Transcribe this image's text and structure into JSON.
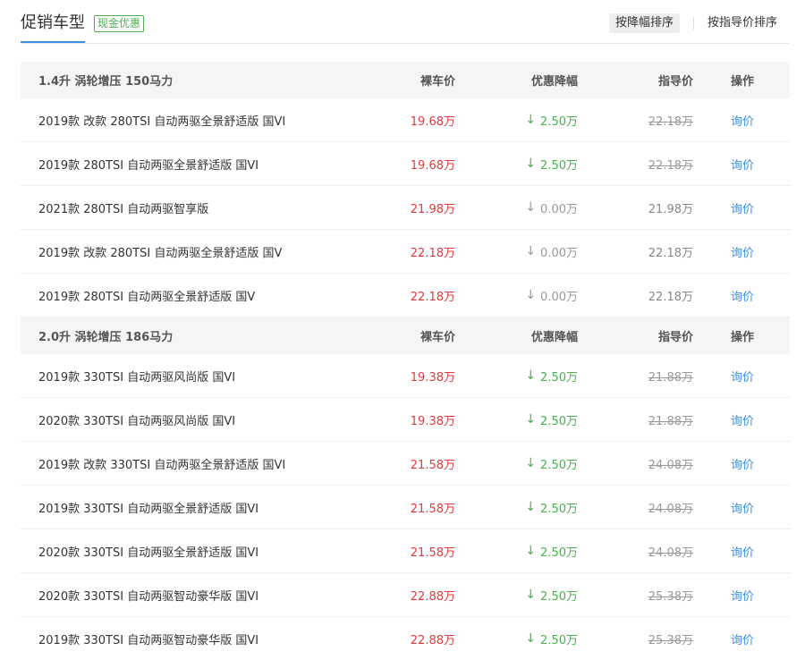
{
  "header": {
    "title": "促销车型",
    "badge": "现金优惠",
    "sort_by_discount": "按降幅排序",
    "sort_by_guide": "按指导价排序"
  },
  "groups": [
    {
      "name": "1.4升 涡轮增压 150马力",
      "col_price": "裸车价",
      "col_discount": "优惠降幅",
      "col_guide": "指导价",
      "col_op": "操作",
      "rows": [
        {
          "name": "2019款 改款 280TSI 自动两驱全景舒适版 国VI",
          "price": "19.68万",
          "discount": "2.50万",
          "guide": "22.18万",
          "op": "询价"
        },
        {
          "name": "2019款 280TSI 自动两驱全景舒适版 国VI",
          "price": "19.68万",
          "discount": "2.50万",
          "guide": "22.18万",
          "op": "询价"
        },
        {
          "name": "2021款 280TSI 自动两驱智享版",
          "price": "21.98万",
          "discount": "0.00万",
          "guide": "21.98万",
          "op": "询价"
        },
        {
          "name": "2019款 改款 280TSI 自动两驱全景舒适版 国V",
          "price": "22.18万",
          "discount": "0.00万",
          "guide": "22.18万",
          "op": "询价"
        },
        {
          "name": "2019款 280TSI 自动两驱全景舒适版 国V",
          "price": "22.18万",
          "discount": "0.00万",
          "guide": "22.18万",
          "op": "询价"
        }
      ]
    },
    {
      "name": "2.0升 涡轮增压 186马力",
      "col_price": "裸车价",
      "col_discount": "优惠降幅",
      "col_guide": "指导价",
      "col_op": "操作",
      "rows": [
        {
          "name": "2019款 330TSI 自动两驱风尚版 国VI",
          "price": "19.38万",
          "discount": "2.50万",
          "guide": "21.88万",
          "op": "询价"
        },
        {
          "name": "2020款 330TSI 自动两驱风尚版 国VI",
          "price": "19.38万",
          "discount": "2.50万",
          "guide": "21.88万",
          "op": "询价"
        },
        {
          "name": "2019款 改款 330TSI 自动两驱全景舒适版 国VI",
          "price": "21.58万",
          "discount": "2.50万",
          "guide": "24.08万",
          "op": "询价"
        },
        {
          "name": "2019款 330TSI 自动两驱全景舒适版 国VI",
          "price": "21.58万",
          "discount": "2.50万",
          "guide": "24.08万",
          "op": "询价"
        },
        {
          "name": "2020款 330TSI 自动两驱全景舒适版 国VI",
          "price": "21.58万",
          "discount": "2.50万",
          "guide": "24.08万",
          "op": "询价"
        },
        {
          "name": "2020款 330TSI 自动两驱智动豪华版 国VI",
          "price": "22.88万",
          "discount": "2.50万",
          "guide": "25.38万",
          "op": "询价"
        },
        {
          "name": "2019款 330TSI 自动两驱智动豪华版 国VI",
          "price": "22.88万",
          "discount": "2.50万",
          "guide": "25.38万",
          "op": "询价"
        }
      ]
    }
  ],
  "icons": {
    "discount_down": "arrow-down-icon"
  },
  "colors": {
    "price": "#e4393c",
    "discount": "#4caf50",
    "link": "#3b8ee8",
    "neutral": "#999999"
  }
}
